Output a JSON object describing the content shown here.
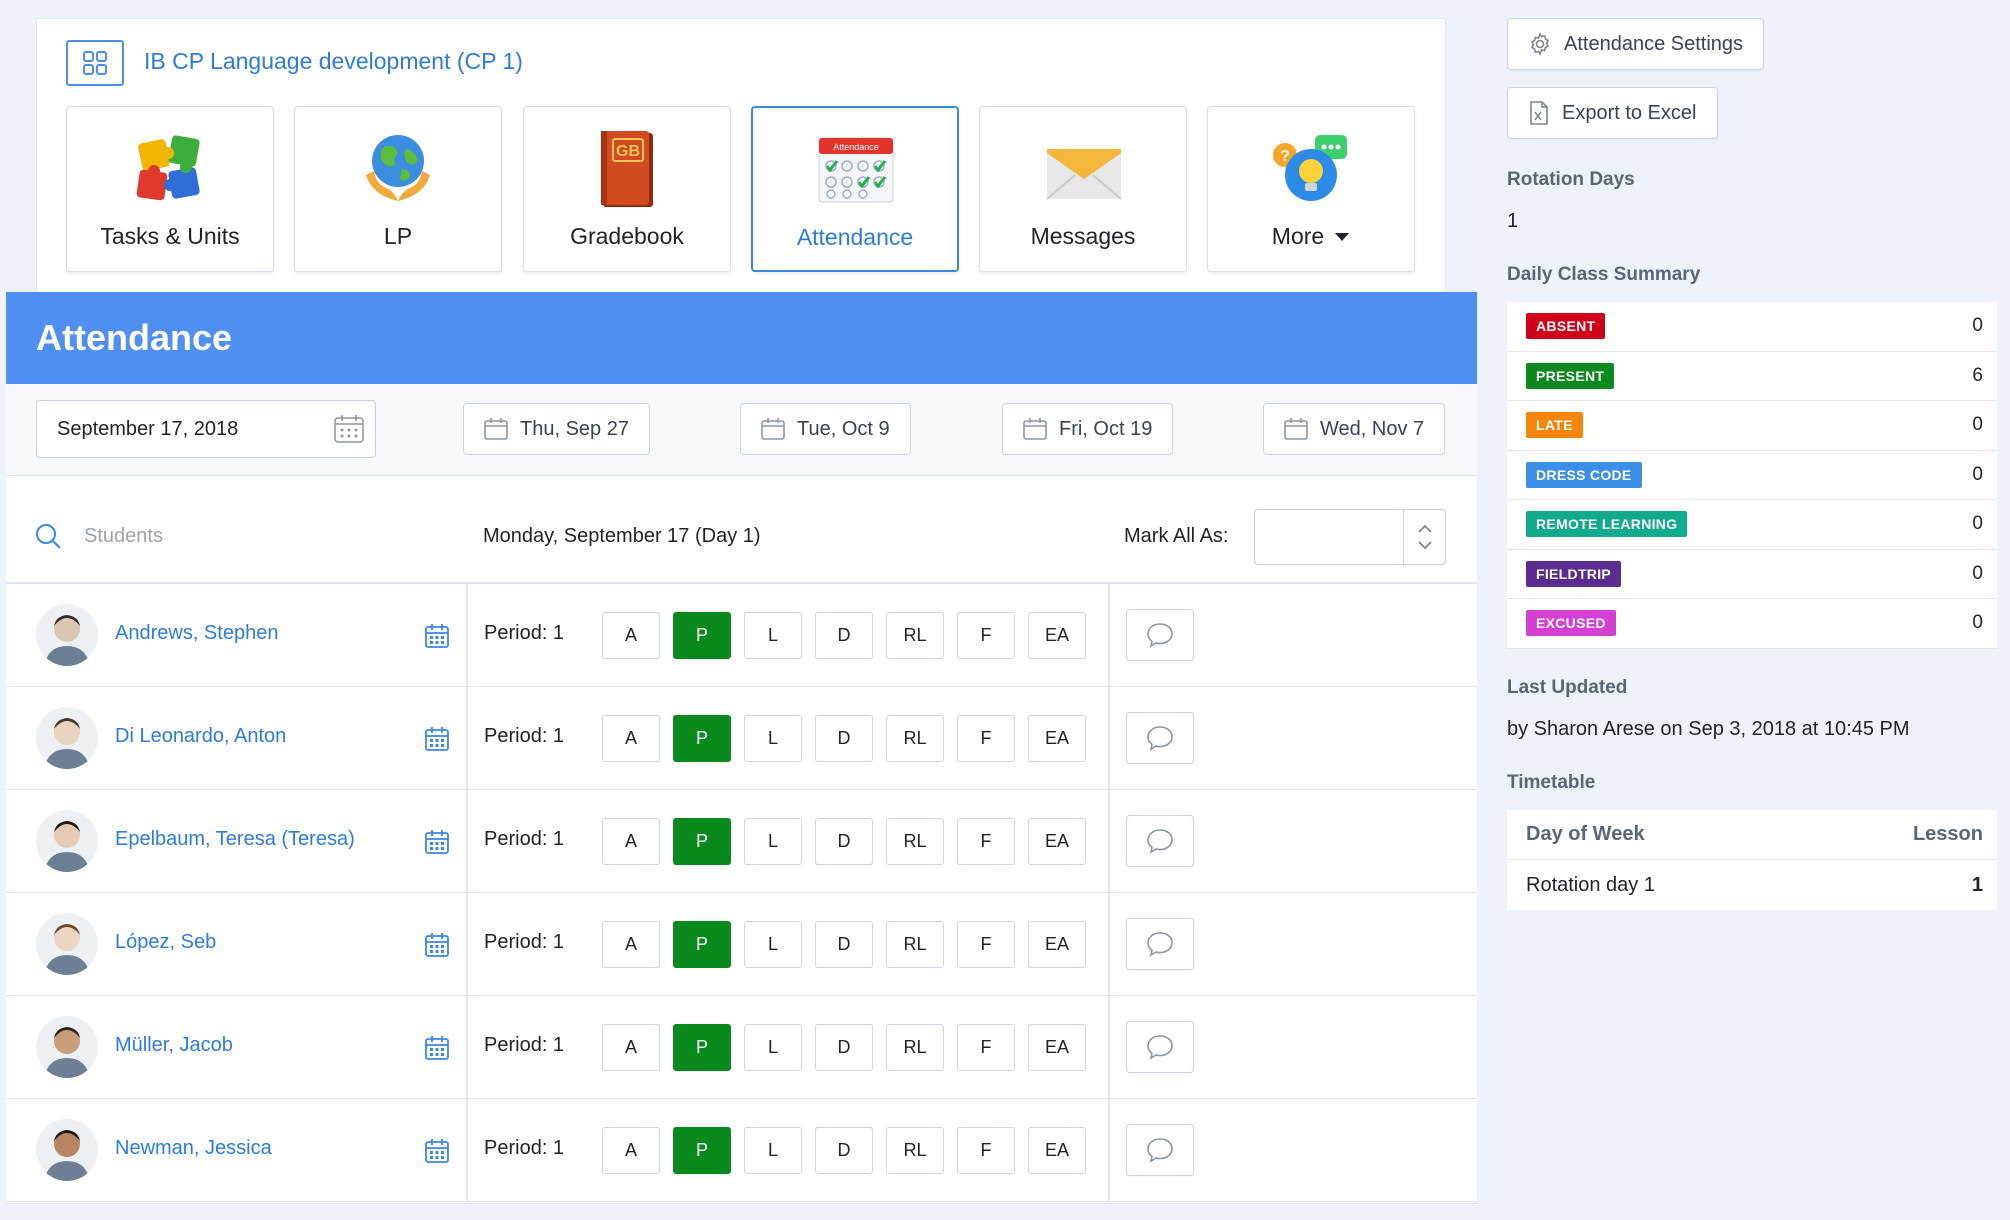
{
  "course": {
    "title": "IB CP Language development (CP 1)",
    "tiles": [
      {
        "label": "Tasks & Units",
        "icon": "puzzle-icon"
      },
      {
        "label": "LP",
        "icon": "globe-hands-icon"
      },
      {
        "label": "Gradebook",
        "icon": "gradebook-book-icon",
        "icon_text": "GB"
      },
      {
        "label": "Attendance",
        "icon": "attendance-calendar-icon",
        "icon_text": "Attendance"
      },
      {
        "label": "Messages",
        "icon": "envelope-icon"
      },
      {
        "label": "More",
        "icon": "lightbulb-chat-icon"
      }
    ]
  },
  "attendance": {
    "title": "Attendance",
    "date_value": "September 17, 2018",
    "quick_dates": [
      "Thu, Sep 27",
      "Tue, Oct 9",
      "Fri, Oct 19",
      "Wed, Nov 7"
    ],
    "search_placeholder": "Students",
    "day_label": "Monday, September 17 (Day 1)",
    "mark_all_label": "Mark All As:",
    "mark_all_value": "",
    "codes": [
      "A",
      "P",
      "L",
      "D",
      "RL",
      "F",
      "EA"
    ],
    "students": [
      {
        "name": "Andrews, Stephen",
        "period": "Period: 1",
        "status": "P"
      },
      {
        "name": "Di Leonardo, Anton",
        "period": "Period: 1",
        "status": "P"
      },
      {
        "name": "Epelbaum, Teresa (Teresa)",
        "period": "Period: 1",
        "status": "P"
      },
      {
        "name": "López, Seb",
        "period": "Period: 1",
        "status": "P"
      },
      {
        "name": "Müller, Jacob",
        "period": "Period: 1",
        "status": "P"
      },
      {
        "name": "Newman, Jessica",
        "period": "Period: 1",
        "status": "P"
      }
    ]
  },
  "sidebar": {
    "settings_button": "Attendance Settings",
    "export_button": "Export to Excel",
    "rotation_heading": "Rotation Days",
    "rotation_value": "1",
    "summary_heading": "Daily Class Summary",
    "summary": [
      {
        "label": "ABSENT",
        "count": "0",
        "color": "#d0021b"
      },
      {
        "label": "PRESENT",
        "count": "6",
        "color": "#0a8a1c"
      },
      {
        "label": "LATE",
        "count": "0",
        "color": "#f5860b"
      },
      {
        "label": "DRESS CODE",
        "count": "0",
        "color": "#3d8ee6"
      },
      {
        "label": "REMOTE LEARNING",
        "count": "0",
        "color": "#13a98c"
      },
      {
        "label": "FIELDTRIP",
        "count": "0",
        "color": "#5b2c8f"
      },
      {
        "label": "EXCUSED",
        "count": "0",
        "color": "#d63fd3"
      }
    ],
    "last_updated_heading": "Last Updated",
    "last_updated_text": "by Sharon Arese on Sep 3, 2018 at 10:45 PM",
    "timetable_heading": "Timetable",
    "timetable_headers": [
      "Day of Week",
      "Lesson"
    ],
    "timetable_rows": [
      {
        "day": "Rotation day 1",
        "lesson": "1"
      }
    ]
  },
  "colors": {
    "accent": "#4f8ff2",
    "link": "#2e7bdf",
    "present_green": "#0a8a1c"
  }
}
